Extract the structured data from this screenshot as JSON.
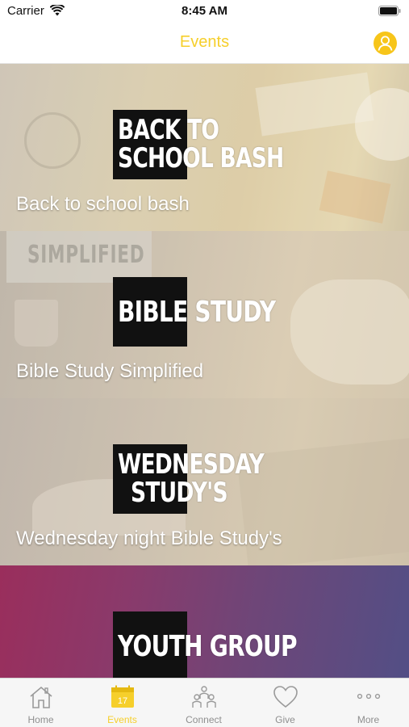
{
  "status_bar": {
    "carrier": "Carrier",
    "time": "8:45 AM"
  },
  "nav": {
    "title": "Events"
  },
  "events": [
    {
      "logo_line1": "BACK TO",
      "logo_line2": "SCHOOL BASH",
      "title": "Back to school bash"
    },
    {
      "logo_line1": "BIBLE STUDY",
      "bg_text": "SIMPLIFIED",
      "title": "Bible Study Simplified"
    },
    {
      "logo_line1": "WEDNESDAY",
      "logo_line2": "STUDY'S",
      "title": "Wednesday night Bible Study's"
    },
    {
      "logo_line1": "YOUTH GROUP",
      "title": ""
    }
  ],
  "tabs": [
    {
      "label": "Home",
      "icon": "home-icon"
    },
    {
      "label": "Events",
      "icon": "calendar-icon",
      "badge": "17",
      "active": true
    },
    {
      "label": "Connect",
      "icon": "people-icon"
    },
    {
      "label": "Give",
      "icon": "heart-icon"
    },
    {
      "label": "More",
      "icon": "more-icon"
    }
  ],
  "colors": {
    "accent": "#f6cf2b",
    "tab_inactive": "#8f8f8f"
  }
}
